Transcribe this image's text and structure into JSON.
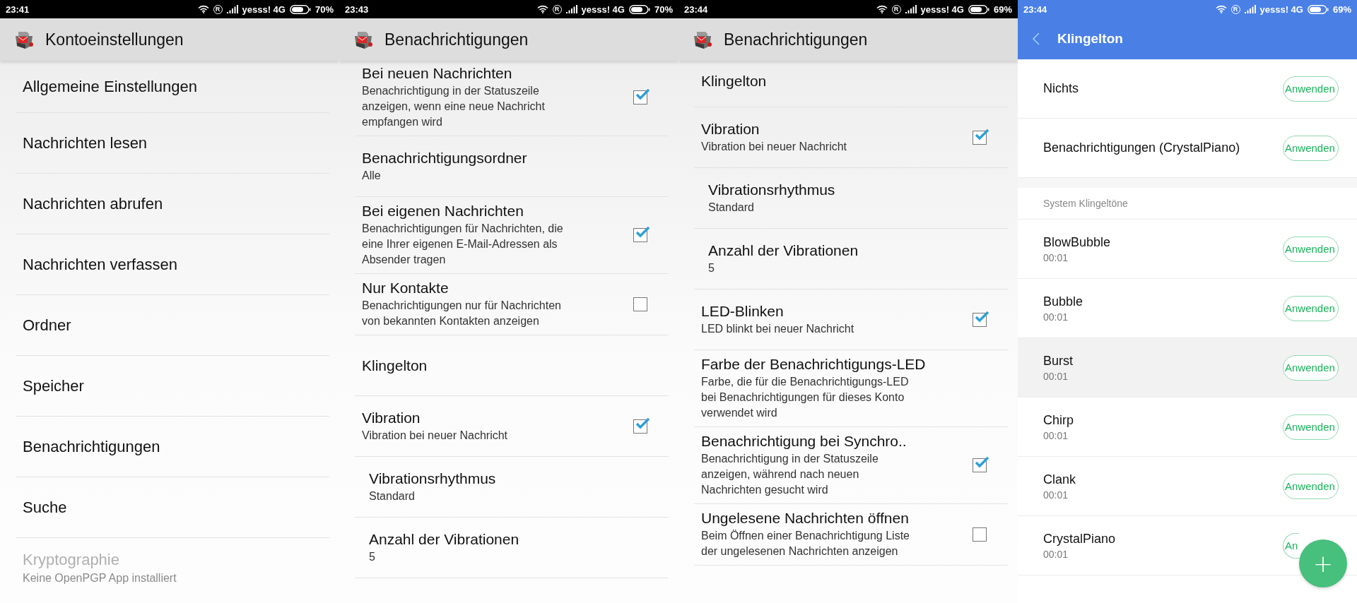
{
  "screens": [
    {
      "kind": "settings",
      "status_bar": {
        "time": "23:41",
        "roaming": "R",
        "carrier": "yesss! 4G",
        "battery": "70%"
      },
      "app_bar": {
        "title": "Kontoeinstellungen"
      },
      "items": [
        {
          "kind": "text",
          "title": "Allgemeine Einstellungen",
          "disabled": false
        },
        {
          "kind": "text",
          "title": "Nachrichten lesen",
          "disabled": false
        },
        {
          "kind": "text",
          "title": "Nachrichten abrufen",
          "disabled": false
        },
        {
          "kind": "text",
          "title": "Nachrichten verfassen",
          "disabled": false
        },
        {
          "kind": "text",
          "title": "Ordner",
          "disabled": false
        },
        {
          "kind": "text",
          "title": "Speicher",
          "disabled": false
        },
        {
          "kind": "text",
          "title": "Benachrichtigungen",
          "disabled": false
        },
        {
          "kind": "text",
          "title": "Suche",
          "disabled": false
        },
        {
          "kind": "text",
          "title": "Kryptographie",
          "summary": "Keine OpenPGP App installiert",
          "disabled": true
        }
      ]
    },
    {
      "kind": "settings",
      "status_bar": {
        "time": "23:43",
        "roaming": "R",
        "carrier": "yesss! 4G",
        "battery": "70%"
      },
      "app_bar": {
        "title": "Benachrichtigungen"
      },
      "items": [
        {
          "kind": "checkbox",
          "title": "Bei neuen Nachrichten",
          "summary": "Benachrichtigung in der Statuszeile anzeigen, wenn eine neue Nachricht empfangen wird",
          "checked": true
        },
        {
          "kind": "text",
          "title": "Benachrichtigungsordner",
          "summary": "Alle"
        },
        {
          "kind": "checkbox",
          "title": "Bei eigenen Nachrichten",
          "summary": "Benachrichtigungen für Nachrichten, die eine Ihrer eigenen E-Mail-Adressen als Absender tragen",
          "checked": true
        },
        {
          "kind": "checkbox",
          "title": "Nur Kontakte",
          "summary": "Benachrichtigungen nur für Nachrichten von bekannten Kontakten anzeigen",
          "checked": false
        },
        {
          "kind": "text",
          "title": "Klingelton"
        },
        {
          "kind": "checkbox",
          "title": "Vibration",
          "summary": "Vibration bei neuer Nachricht",
          "checked": true,
          "children": [
            {
              "kind": "text",
              "title": "Vibrationsrhythmus",
              "summary": "Standard"
            },
            {
              "kind": "text",
              "title": "Anzahl der Vibrationen",
              "summary": "5"
            }
          ]
        }
      ]
    },
    {
      "kind": "settings",
      "status_bar": {
        "time": "23:44",
        "roaming": "R",
        "carrier": "yesss! 4G",
        "battery": "69%"
      },
      "app_bar": {
        "title": "Benachrichtigungen"
      },
      "items": [
        {
          "kind": "text",
          "title": "Klingelton"
        },
        {
          "kind": "checkbox",
          "title": "Vibration",
          "summary": "Vibration bei neuer Nachricht",
          "checked": true,
          "children": [
            {
              "kind": "text",
              "title": "Vibrationsrhythmus",
              "summary": "Standard"
            },
            {
              "kind": "text",
              "title": "Anzahl der Vibrationen",
              "summary": "5"
            }
          ]
        },
        {
          "kind": "checkbox",
          "title": "LED-Blinken",
          "summary": "LED blinkt bei neuer Nachricht",
          "checked": true
        },
        {
          "kind": "text",
          "title": "Farbe der Benachrichtigungs-LED",
          "summary": "Farbe, die für die Benachrichtigungs-LED bei Benachrichtigungen für dieses Konto verwendet wird"
        },
        {
          "kind": "checkbox",
          "title": "Benachrichtigung bei Synchro..",
          "summary": "Benachrichtigung in der Statuszeile anzeigen, während nach neuen Nachrichten gesucht wird",
          "checked": true
        },
        {
          "kind": "checkbox",
          "title": "Ungelesene Nachrichten öffnen",
          "summary": "Beim Öffnen einer Benachrichtigung Liste der ungelesenen Nachrichten anzeigen",
          "checked": false
        }
      ]
    },
    {
      "kind": "ringtones",
      "status_bar": {
        "time": "23:44",
        "roaming": "R",
        "carrier": "yesss! 4G",
        "battery": "69%"
      },
      "app_bar": {
        "title": "Klingelton"
      },
      "items": [
        {
          "kind": "option",
          "title": "Nichts",
          "button": "Anwenden",
          "selected": false
        },
        {
          "kind": "option",
          "title": "Benachrichtigungen (CrystalPiano)",
          "button": "Anwenden",
          "selected": false
        },
        {
          "kind": "header",
          "title": "System Klingeltöne"
        },
        {
          "kind": "option",
          "title": "BlowBubble",
          "duration": "00:01",
          "button": "Anwenden",
          "selected": false
        },
        {
          "kind": "option",
          "title": "Bubble",
          "duration": "00:01",
          "button": "Anwenden",
          "selected": false
        },
        {
          "kind": "option",
          "title": "Burst",
          "duration": "00:01",
          "button": "Anwenden",
          "selected": true
        },
        {
          "kind": "option",
          "title": "Chirp",
          "duration": "00:01",
          "button": "Anwenden",
          "selected": false
        },
        {
          "kind": "option",
          "title": "Clank",
          "duration": "00:01",
          "button": "Anwenden",
          "selected": false
        },
        {
          "kind": "option",
          "title": "CrystalPiano",
          "duration": "00:01",
          "button": "An",
          "selected": false
        }
      ],
      "fab": {
        "label": "+"
      }
    }
  ]
}
